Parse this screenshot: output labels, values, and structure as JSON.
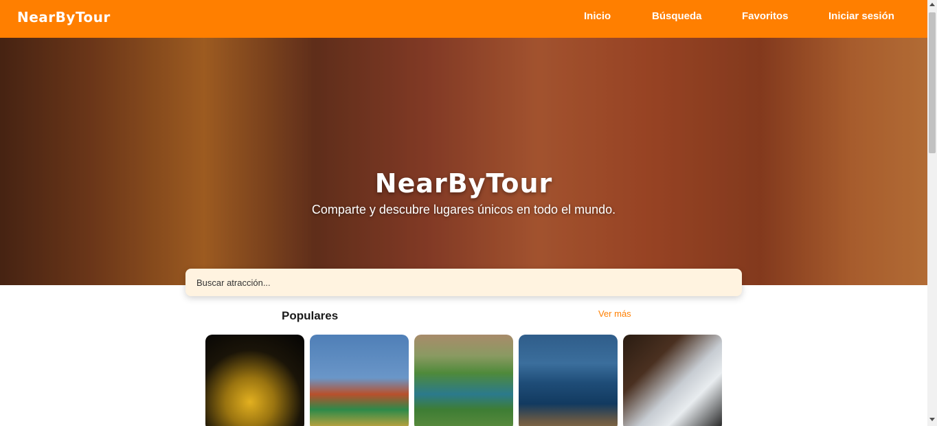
{
  "header": {
    "brand": "NearByTour",
    "nav": [
      {
        "label": "Inicio"
      },
      {
        "label": "Búsqueda"
      },
      {
        "label": "Favoritos"
      },
      {
        "label": "Iniciar sesión"
      }
    ]
  },
  "hero": {
    "title": "NearByTour",
    "subtitle": "Comparte y descubre lugares únicos en todo el mundo."
  },
  "search": {
    "placeholder": "Buscar atracción..."
  },
  "popular": {
    "title": "Populares",
    "see_more": "Ver más"
  },
  "colors": {
    "accent": "#ff7f00",
    "search_bg": "#fff3e0"
  }
}
